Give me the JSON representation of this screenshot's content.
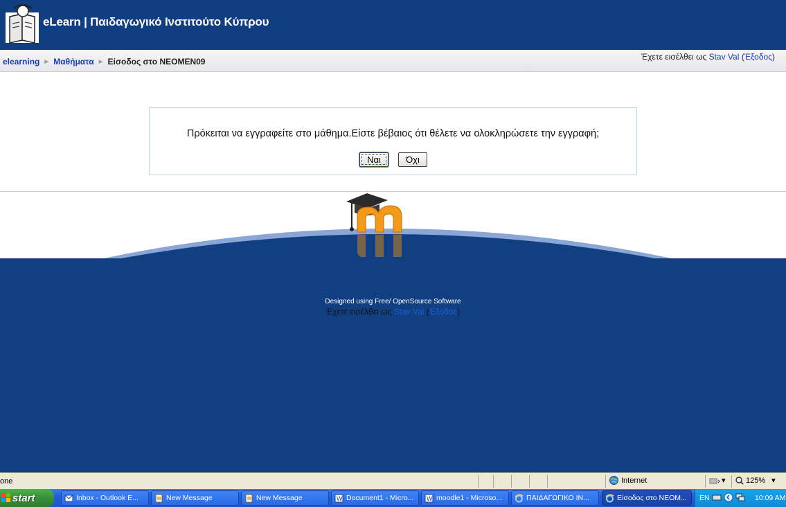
{
  "header": {
    "site_title": "eLearn | Παιδαγωγικό Ινστιτούτο Κύπρου"
  },
  "navbar": {
    "breadcrumb": [
      "elearning",
      "Μαθήματα",
      "Είσοδος στο NEOMEN09"
    ],
    "login_prefix": "Έχετε εισέλθει ως ",
    "login_user": "Stav Val",
    "logout_label": "Έξοδος"
  },
  "confirm": {
    "message": "Πρόκειται να εγγραφείτε στο μάθημα.Είστε βέβαιος ότι θέλετε να ολοκληρώσετε την εγγραφή;",
    "yes_label": "Ναι",
    "no_label": "Όχι"
  },
  "footer": {
    "designed_text": "Designed using Free/ OpenSource Software",
    "login_prefix": "Έχετε εισέλθει ως ",
    "login_user": "Stav Val",
    "logout_label": "Έξοδος"
  },
  "statusbar": {
    "status_text": "one",
    "zone_label": "Internet",
    "zoom_label": "125%"
  },
  "taskbar": {
    "start_label": "start",
    "tasks": [
      {
        "label": "Inbox - Outlook E...",
        "icon": "outlook-icon"
      },
      {
        "label": "New Message",
        "icon": "message-icon"
      },
      {
        "label": "New Message",
        "icon": "message-icon"
      },
      {
        "label": "Document1 - Micro...",
        "icon": "word-icon"
      },
      {
        "label": "moodle1 - Microso...",
        "icon": "word-icon"
      },
      {
        "label": "ΠΑΙΔΑΓΩΓΙΚΟ ΙΝ...",
        "icon": "ie-icon"
      },
      {
        "label": "Είσοδος στο NEOM...",
        "icon": "ie-icon"
      }
    ],
    "tray_lang": "EN",
    "clock": "10:09 AM"
  },
  "colors": {
    "header_bg": "#103e80",
    "link": "#1a3cb4",
    "footer_bg": "#123f82",
    "taskbar": "#245edb",
    "start_green": "#3a8e3a"
  }
}
